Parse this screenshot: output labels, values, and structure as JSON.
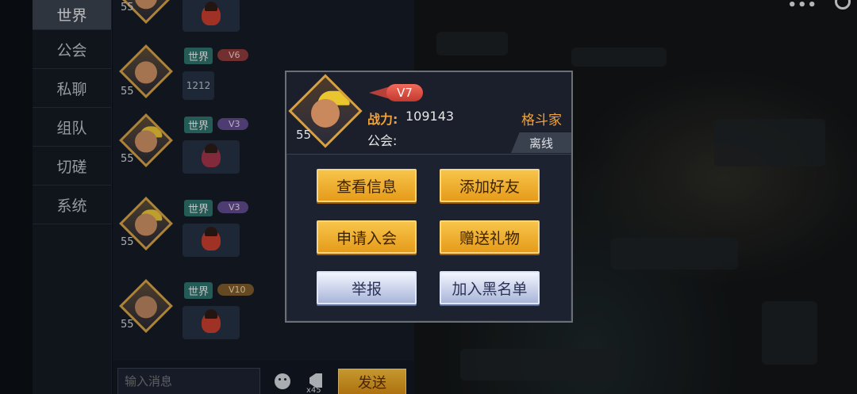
{
  "tabs": [
    {
      "label": "世界",
      "active": true
    },
    {
      "label": "公会"
    },
    {
      "label": "私聊"
    },
    {
      "label": "组队"
    },
    {
      "label": "切磋"
    },
    {
      "label": "系统"
    }
  ],
  "messages": [
    {
      "level": "55"
    },
    {
      "level": "55",
      "channel": "世界",
      "vip": "V6",
      "text": "1212"
    },
    {
      "level": "55",
      "channel": "世界",
      "vip": "V3"
    },
    {
      "level": "55",
      "channel": "世界",
      "vip": "V3"
    },
    {
      "level": "55",
      "channel": "世界",
      "vip": "V10"
    }
  ],
  "input": {
    "placeholder": "输入消息",
    "send_label": "发送",
    "horn_count": "x45"
  },
  "profile": {
    "level": "55",
    "vip": "V7",
    "power_label": "战力:",
    "power_value": "109143",
    "guild_label": "公会:",
    "role": "格斗家",
    "status": "离线"
  },
  "actions": {
    "view_info": "查看信息",
    "add_friend": "添加好友",
    "apply_guild": "申请入会",
    "send_gift": "赠送礼物",
    "report": "举报",
    "blacklist": "加入黑名单"
  }
}
